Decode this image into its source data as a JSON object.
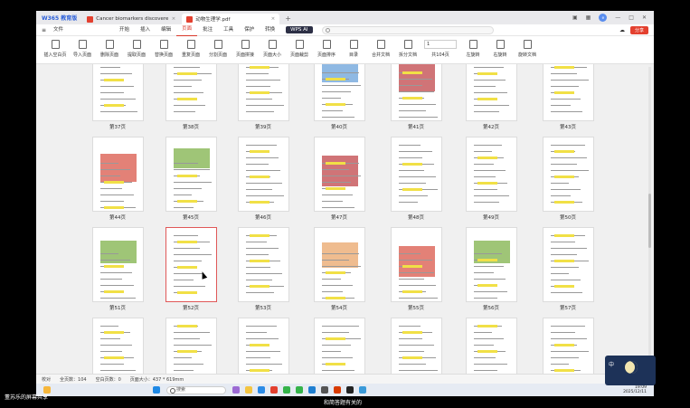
{
  "app": {
    "brand": "W365 教育版"
  },
  "tabs": [
    {
      "label": "Cancer biomarkers discovere",
      "active": false
    },
    {
      "label": "动物生理学.pdf",
      "active": true
    }
  ],
  "window_controls": {
    "avatar": "e"
  },
  "menu": {
    "file": "文件",
    "items": [
      "开始",
      "插入",
      "编辑",
      "页面",
      "批注",
      "工具",
      "保护",
      "转换"
    ],
    "active": "页面",
    "wps_ai": "WPS AI",
    "share": "分享"
  },
  "toolbar": {
    "buttons": [
      "插入空白页",
      "导入页面",
      "删除页面",
      "提取页面",
      "替换页面",
      "重复页面",
      "分割页面",
      "页面拼接",
      "页面大小",
      "页面裁剪",
      "页面排序",
      "目录",
      "合并文档",
      "拆分文档"
    ],
    "page_field": "1",
    "page_total": "共104页",
    "rotate": [
      "左旋转",
      "右旋转",
      "旋转文档"
    ]
  },
  "pages": [
    {
      "label": "第37页"
    },
    {
      "label": "第38页"
    },
    {
      "label": "第39页"
    },
    {
      "label": "第40页"
    },
    {
      "label": "第41页"
    },
    {
      "label": "第42页"
    },
    {
      "label": "第43页"
    },
    {
      "label": "第44页"
    },
    {
      "label": "第45页"
    },
    {
      "label": "第46页"
    },
    {
      "label": "第47页"
    },
    {
      "label": "第48页"
    },
    {
      "label": "第49页"
    },
    {
      "label": "第50页"
    },
    {
      "label": "第51页"
    },
    {
      "label": "第52页"
    },
    {
      "label": "第53页"
    },
    {
      "label": "第54页"
    },
    {
      "label": "第55页"
    },
    {
      "label": "第56页"
    },
    {
      "label": "第57页"
    }
  ],
  "selected_page": "第52页",
  "statusbar": {
    "mode": "校对",
    "page_count": "全页数：104",
    "blank_pages": "空白页数：0",
    "page_size": "页面大小：437 * 619mm"
  },
  "taskbar": {
    "search": "搜索",
    "time": "19:09",
    "date": "2025/12/11"
  },
  "overlay": {
    "share_caption": "董苏乐的屏幕共享",
    "subtitle": "和简答题有关的",
    "video_char": "中"
  }
}
